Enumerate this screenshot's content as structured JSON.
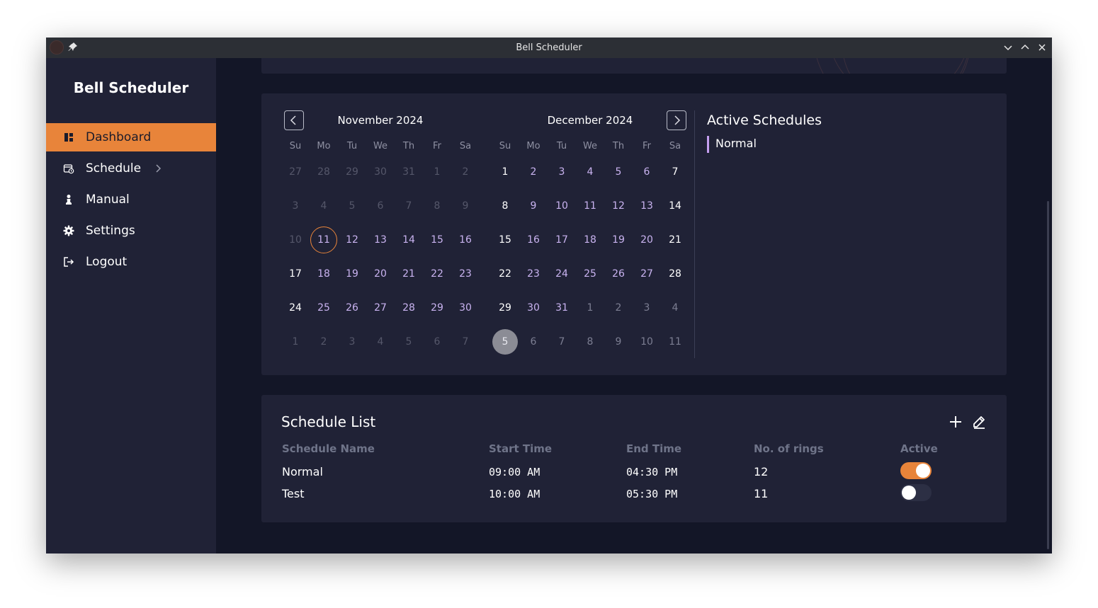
{
  "window": {
    "title": "Bell Scheduler"
  },
  "sidebar": {
    "brand": "Bell Scheduler",
    "items": [
      {
        "label": "Dashboard",
        "icon": "dashboard-icon",
        "active": true
      },
      {
        "label": "Schedule",
        "icon": "calendar-clock-icon",
        "active": false,
        "has_submenu": true
      },
      {
        "label": "Manual",
        "icon": "person-icon",
        "active": false
      },
      {
        "label": "Settings",
        "icon": "gear-icon",
        "active": false
      },
      {
        "label": "Logout",
        "icon": "logout-icon",
        "active": false
      }
    ]
  },
  "calendar": {
    "weekdays": [
      "Su",
      "Mo",
      "Tu",
      "We",
      "Th",
      "Fr",
      "Sa"
    ],
    "months": [
      {
        "title": "November 2024",
        "weeks": [
          [
            "27",
            "28",
            "29",
            "30",
            "31",
            "1",
            "2"
          ],
          [
            "3",
            "4",
            "5",
            "6",
            "7",
            "8",
            "9"
          ],
          [
            "10",
            "11",
            "12",
            "13",
            "14",
            "15",
            "16"
          ],
          [
            "17",
            "18",
            "19",
            "20",
            "21",
            "22",
            "23"
          ],
          [
            "24",
            "25",
            "26",
            "27",
            "28",
            "29",
            "30"
          ],
          [
            "1",
            "2",
            "3",
            "4",
            "5",
            "6",
            "7"
          ]
        ]
      },
      {
        "title": "December 2024",
        "weeks": [
          [
            "1",
            "2",
            "3",
            "4",
            "5",
            "6",
            "7"
          ],
          [
            "8",
            "9",
            "10",
            "11",
            "12",
            "13",
            "14"
          ],
          [
            "15",
            "16",
            "17",
            "18",
            "19",
            "20",
            "21"
          ],
          [
            "22",
            "23",
            "24",
            "25",
            "26",
            "27",
            "28"
          ],
          [
            "29",
            "30",
            "31",
            "1",
            "2",
            "3",
            "4"
          ],
          [
            "5",
            "6",
            "7",
            "8",
            "9",
            "10",
            "11"
          ]
        ]
      }
    ],
    "today": "November 11",
    "selected": "January 5"
  },
  "active_schedules": {
    "title": "Active Schedules",
    "items": [
      "Normal"
    ]
  },
  "schedule_list": {
    "title": "Schedule List",
    "columns": [
      "Schedule Name",
      "Start Time",
      "End Time",
      "No. of rings",
      "Active"
    ],
    "rows": [
      {
        "name": "Normal",
        "start": "09:00 AM",
        "end": "04:30 PM",
        "rings": "12",
        "active": true
      },
      {
        "name": "Test",
        "start": "10:00 AM",
        "end": "05:30 PM",
        "rings": "11",
        "active": false
      }
    ]
  },
  "colors": {
    "accent": "#e8843a",
    "sidebar_bg": "#202236",
    "main_bg": "#131627",
    "card_bg": "#202236",
    "weekday_text": "#c9b3f0",
    "active_schedule_marker": "#c59ff0"
  }
}
